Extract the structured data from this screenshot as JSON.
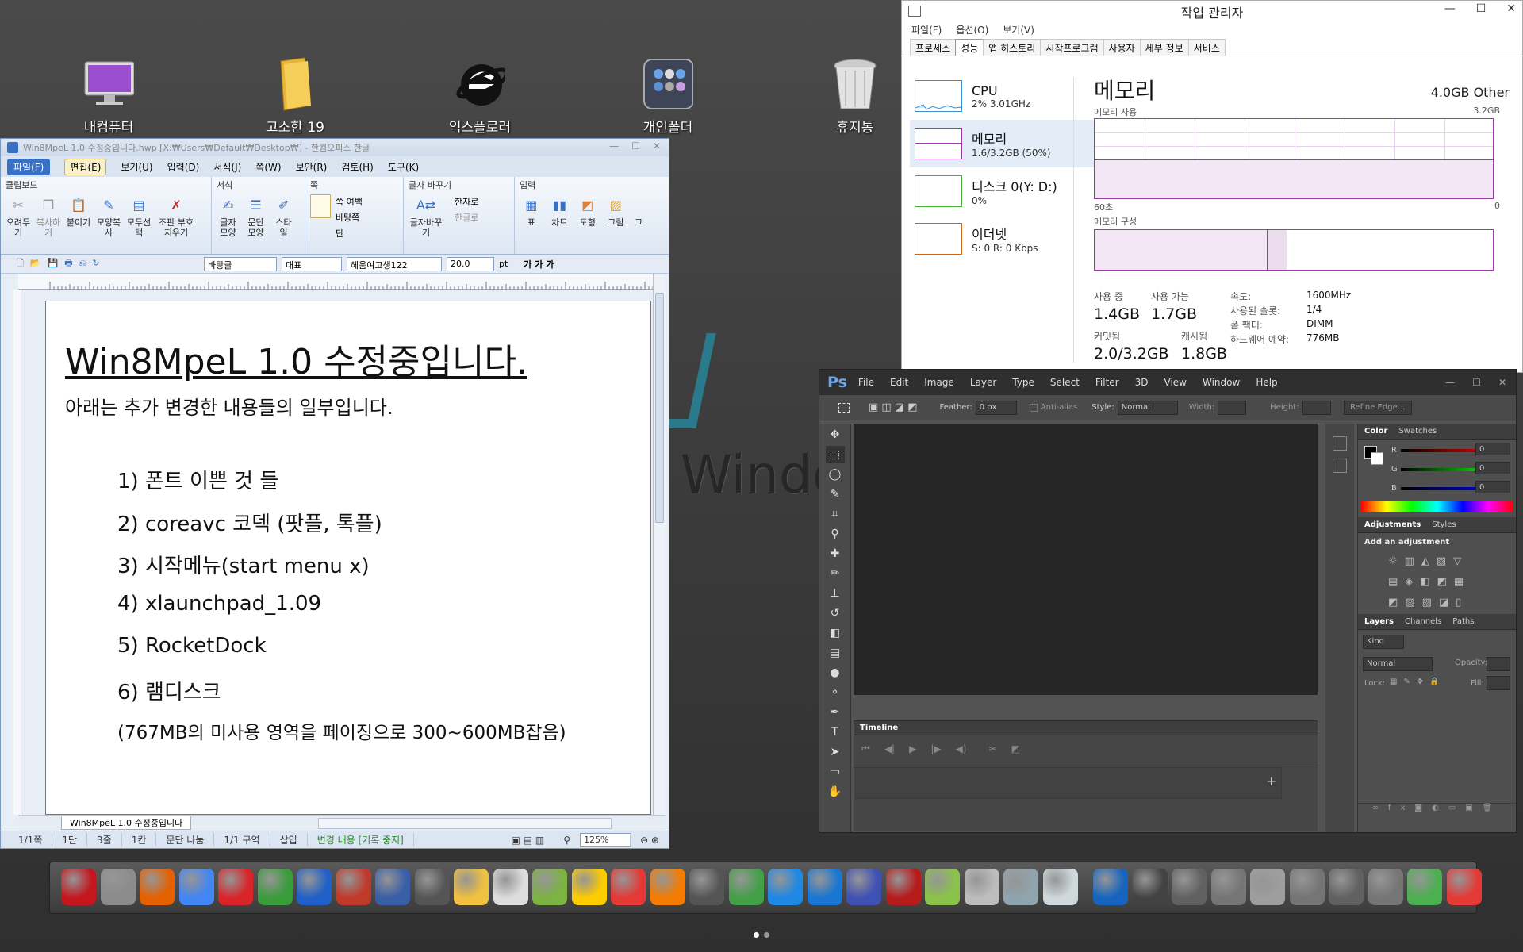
{
  "desktop": {
    "icons": [
      {
        "label": "내컴퓨터"
      },
      {
        "label": "고소한 19"
      },
      {
        "label": "익스플로러"
      },
      {
        "label": "개인폴더"
      },
      {
        "label": "휴지통"
      }
    ],
    "watermark": "Windo"
  },
  "taskmgr": {
    "title": "작업 관리자",
    "menu": [
      "파일(F)",
      "옵션(O)",
      "보기(V)"
    ],
    "tabs": [
      "프로세스",
      "성능",
      "앱 히스토리",
      "시작프로그램",
      "사용자",
      "세부 정보",
      "서비스"
    ],
    "sidebar": [
      {
        "name": "CPU",
        "detail": "2% 3.01GHz"
      },
      {
        "name": "메모리",
        "detail": "1.6/3.2GB (50%)"
      },
      {
        "name": "디스크 0(Y: D:)",
        "detail": "0%"
      },
      {
        "name": "이더넷",
        "detail": "S: 0 R: 0 Kbps"
      }
    ],
    "main_title": "메모리",
    "total": "4.0GB Other",
    "usage_label": "메모리 사용",
    "usage_max": "3.2GB",
    "axis_left": "60초",
    "axis_right": "0",
    "composition_label": "메모리 구성",
    "stats": {
      "in_use_label": "사용 중",
      "in_use": "1.4GB",
      "available_label": "사용 가능",
      "available": "1.7GB",
      "committed_label": "커밋됨",
      "committed": "2.0/3.2GB",
      "cached_label": "캐시됨",
      "cached": "1.8GB",
      "speed_label": "속도:",
      "speed": "1600MHz",
      "slots_label": "사용된 슬롯:",
      "slots": "1/4",
      "form_label": "폼 팩터:",
      "form": "DIMM",
      "hw_label": "하드웨어 예약:",
      "hw": "776MB"
    }
  },
  "photoshop": {
    "logo": "Ps",
    "menu": [
      "File",
      "Edit",
      "Image",
      "Layer",
      "Type",
      "Select",
      "Filter",
      "3D",
      "View",
      "Window",
      "Help"
    ],
    "options": {
      "feather_label": "Feather:",
      "feather": "0 px",
      "antialias": "Anti-alias",
      "style_label": "Style:",
      "style": "Normal",
      "width_label": "Width:",
      "height_label": "Height:",
      "refine": "Refine Edge..."
    },
    "timeline_label": "Timeline",
    "color_tabs": [
      "Color",
      "Swatches"
    ],
    "rgb": [
      {
        "ch": "R",
        "v": "0"
      },
      {
        "ch": "G",
        "v": "0"
      },
      {
        "ch": "B",
        "v": "0"
      }
    ],
    "adj_tabs": [
      "Adjustments",
      "Styles"
    ],
    "adj_title": "Add an adjustment",
    "layer_tabs": [
      "Layers",
      "Channels",
      "Paths"
    ],
    "kind": "Kind",
    "blend": "Normal",
    "opacity_label": "Opacity:",
    "lock_label": "Lock:",
    "fill_label": "Fill:"
  },
  "hwp": {
    "title": "Win8MpeL 1.0 수정중입니다.hwp [X:₩Users₩Default₩Desktop₩] - 한컴오피스 한글",
    "menu": [
      "파일(F)",
      "편집(E)",
      "보기(U)",
      "입력(D)",
      "서식(J)",
      "쪽(W)",
      "보안(R)",
      "검토(H)",
      "도구(K)"
    ],
    "groups": [
      "클립보드",
      "서식",
      "쪽",
      "글자 바꾸기",
      "입력"
    ],
    "clip_btns": [
      "오려두기",
      "복사하기",
      "붙이기",
      "모양복사",
      "모두선택",
      "조판 부호 지우기"
    ],
    "fmt_btns": [
      "글자모양",
      "문단모양",
      "스타일"
    ],
    "page_btns": [
      "쪽 여백",
      "바탕쪽",
      "단"
    ],
    "change_btns": [
      "글자바꾸기",
      "한자로",
      "한글로"
    ],
    "input_btns": [
      "표",
      "차트",
      "도형",
      "그림",
      "그"
    ],
    "toolbar": {
      "style": "바탕글",
      "lang": "대표",
      "font": "헤움여고생122",
      "size": "20.0",
      "unit": "pt",
      "ga": "가 가 가"
    },
    "doc": {
      "heading": "Win8MpeL 1.0 수정중입니다.",
      "intro": "아래는 추가 변경한 내용들의 일부입니다.",
      "items": [
        "1) 폰트 이쁜 것 들",
        "2) coreavc 코덱 (팟플, 톡플)",
        "3) 시작메뉴(start menu x)",
        "4) xlaunchpad_1.09",
        "5) RocketDock",
        "6) 램디스크",
        "(767MB의 미사용 영역을 페이징으로 300~600MB잡음)"
      ]
    },
    "tab_label": "Win8MpeL 1.0 수정중입니다",
    "status": [
      "1/1쪽",
      "1단",
      "3줄",
      "1칸",
      "문단 나눔",
      "1/1 구역",
      "삽입",
      "변경 내용 [기록 중지]"
    ],
    "zoom": "125%"
  },
  "dock": {
    "colors": [
      "#c4161c",
      "#8c8c8c",
      "#e66000",
      "#4285f4",
      "#d9252a",
      "#3a9c3a",
      "#2060c8",
      "#c03a2a",
      "#3a5ea8",
      "#555555",
      "#f0c040",
      "#dddddd",
      "#7cb342",
      "#ffcc00",
      "#e53935",
      "#f57c00",
      "#555555",
      "#43a047",
      "#1e88e5",
      "#1976d2",
      "#3f51b5",
      "#b71c1c",
      "#8bc34a",
      "#bdbdbd",
      "#90a4ae",
      "#cfd8dc",
      "#1565c0",
      "#424242",
      "#616161",
      "#757575",
      "#9e9e9e",
      "#757575",
      "#616161",
      "#757575",
      "#4caf50",
      "#e53935"
    ]
  }
}
